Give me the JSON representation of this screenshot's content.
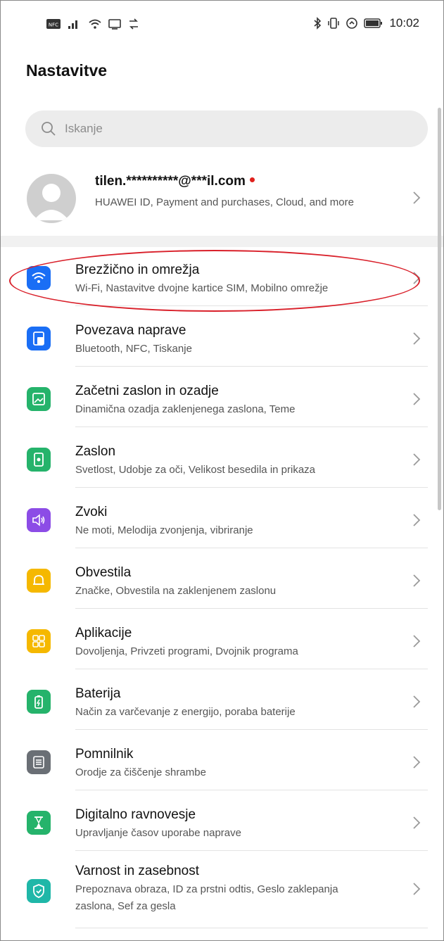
{
  "status_bar": {
    "time": "10:02",
    "left_icons": [
      "nfc-icon",
      "signal-icon",
      "wifi-icon",
      "cast-icon",
      "sync-icon"
    ],
    "right_icons": [
      "bluetooth-icon",
      "vibrate-icon",
      "data-saver-icon",
      "battery-icon"
    ]
  },
  "header": {
    "title": "Nastavitve"
  },
  "search": {
    "placeholder": "Iskanje"
  },
  "account": {
    "name": "tilen.**********@***il.com",
    "description": "HUAWEI ID, Payment and purchases, Cloud, and more"
  },
  "colors": {
    "wifi": "#1a6ef5",
    "device": "#1a6ef5",
    "home": "#25b36b",
    "display": "#25b36b",
    "sound": "#8c4ce6",
    "notify": "#f5b800",
    "apps": "#f5b800",
    "battery": "#25b36b",
    "storage": "#6a6f75",
    "wellbeing": "#25b36b",
    "security": "#1fb7a8",
    "highlight": "#d9202a",
    "red_dot": "#e0211d"
  },
  "settings": [
    {
      "title": "Brezžično in omrežja",
      "subtitle": "Wi-Fi, Nastavitve dvojne kartice SIM, Mobilno omrežje",
      "icon": "wifi-icon"
    },
    {
      "title": "Povezava naprave",
      "subtitle": "Bluetooth, NFC, Tiskanje",
      "icon": "device-connection-icon"
    },
    {
      "title": "Začetni zaslon in ozadje",
      "subtitle": "Dinamična ozadja zaklenjenega zaslona, Teme",
      "icon": "wallpaper-icon"
    },
    {
      "title": "Zaslon",
      "subtitle": "Svetlost, Udobje za oči, Velikost besedila in prikaza",
      "icon": "display-icon"
    },
    {
      "title": "Zvoki",
      "subtitle": "Ne moti, Melodija zvonjenja, vibriranje",
      "icon": "sound-icon"
    },
    {
      "title": "Obvestila",
      "subtitle": "Značke, Obvestila na zaklenjenem zaslonu",
      "icon": "bell-icon"
    },
    {
      "title": "Aplikacije",
      "subtitle": "Dovoljenja, Privzeti programi, Dvojnik programa",
      "icon": "apps-icon"
    },
    {
      "title": "Baterija",
      "subtitle": "Način za varčevanje z energijo, poraba baterije",
      "icon": "battery-icon"
    },
    {
      "title": "Pomnilnik",
      "subtitle": "Orodje za čiščenje shrambe",
      "icon": "storage-icon"
    },
    {
      "title": "Digitalno ravnovesje",
      "subtitle": "Upravljanje časov uporabe naprave",
      "icon": "hourglass-icon"
    },
    {
      "title": "Varnost in zasebnost",
      "subtitle": "Prepoznava obraza, ID za prstni odtis, Geslo zaklepanja",
      "subtitle2": "zaslona, Sef za gesla",
      "icon": "shield-icon"
    }
  ]
}
